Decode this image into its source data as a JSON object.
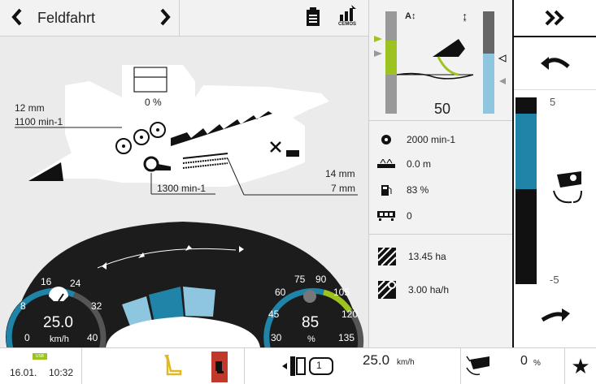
{
  "header": {
    "title": "Feldfahrt",
    "prev_icon": "chevron-left-icon",
    "next_icon": "chevron-right-icon",
    "clipboard_icon": "clipboard-icon",
    "cemos_label": "CEMOS"
  },
  "machine": {
    "grain_loss": "0 %",
    "cut_height": "12 mm",
    "reel_speed": "1100 min-1",
    "drum_speed": "1300 min-1",
    "sieve_upper": "14 mm",
    "sieve_lower": "7 mm"
  },
  "header_control": {
    "value": "50",
    "top_icon": "header-float-icon",
    "height_icon": "height-arrows-icon"
  },
  "info": {
    "engine_speed": "2000 min-1",
    "cut_width": "0.0 m",
    "fuel": "83 %",
    "counter": "0",
    "area": "13.45 ha",
    "area_rate": "3.00 ha/h"
  },
  "side": {
    "scale_top": "5",
    "scale_bottom": "-5",
    "expand_icon": "double-chevron-right-icon",
    "fill_level": 0.45
  },
  "gauges": {
    "speed": {
      "value": "25.0",
      "unit": "km/h",
      "ticks": [
        "0",
        "8",
        "16",
        "24",
        "32",
        "40"
      ],
      "fraction": 0.625
    },
    "load": {
      "value": "85",
      "unit": "%",
      "ticks": [
        "30",
        "45",
        "60",
        "75",
        "90",
        "105",
        "120",
        "135"
      ],
      "fraction": 0.52
    }
  },
  "footer": {
    "date": "16.01.",
    "time": "10:32",
    "usb_label": "USB",
    "speed_value": "25.0",
    "speed_unit": "km/h",
    "gear": "1",
    "tilt_value": "0",
    "tilt_unit": "%"
  },
  "colors": {
    "accent_blue": "#1f84a8",
    "light_blue": "#8fc6df",
    "green": "#9cc31f",
    "dark": "#222222",
    "red": "#c0392b"
  }
}
